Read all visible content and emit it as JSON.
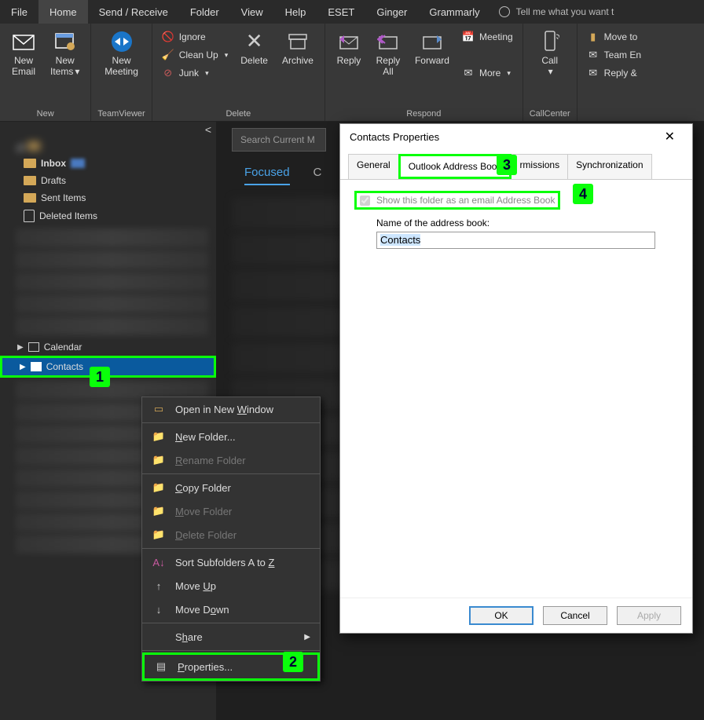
{
  "tabs": {
    "file": "File",
    "home": "Home",
    "sendreceive": "Send / Receive",
    "folder": "Folder",
    "view": "View",
    "help": "Help",
    "eset": "ESET",
    "ginger": "Ginger",
    "grammarly": "Grammarly",
    "tell": "Tell me what you want t"
  },
  "ribbon": {
    "new": {
      "email": "New\nEmail",
      "items": "New\nItems",
      "label": "New"
    },
    "tv": {
      "meeting": "New\nMeeting",
      "label": "TeamViewer"
    },
    "delete": {
      "ignore": "Ignore",
      "cleanup": "Clean Up",
      "junk": "Junk",
      "delete": "Delete",
      "archive": "Archive",
      "label": "Delete"
    },
    "respond": {
      "reply": "Reply",
      "replyall": "Reply\nAll",
      "forward": "Forward",
      "meeting": "Meeting",
      "more": "More",
      "label": "Respond"
    },
    "call": {
      "call": "Call",
      "label": "CallCenter"
    },
    "move": {
      "moveto": "Move to",
      "teamen": "Team En",
      "replyd": "Reply &"
    }
  },
  "search": {
    "placeholder": "Search Current M"
  },
  "focus": {
    "focused": "Focused",
    "other": "C"
  },
  "folders": {
    "inbox": "Inbox",
    "drafts": "Drafts",
    "sent": "Sent Items",
    "deleted": "Deleted Items",
    "calendar": "Calendar",
    "contacts": "Contacts"
  },
  "context": {
    "open": "Open in New Window",
    "newf": "New Folder...",
    "rename": "Rename Folder",
    "copy": "Copy Folder",
    "move": "Move Folder",
    "delete": "Delete Folder",
    "sort": "Sort Subfolders A to Z",
    "moveup": "Move Up",
    "movedown": "Move Down",
    "share": "Share",
    "props": "Properties..."
  },
  "dialog": {
    "title": "Contacts Properties",
    "tabs": {
      "general": "General",
      "oab": "Outlook Address Book",
      "perm": "rmissions",
      "sync": "Synchronization"
    },
    "chk": "Show this folder as an email Address Book",
    "namelbl": "Name of the address book:",
    "nameval": "Contacts",
    "ok": "OK",
    "cancel": "Cancel",
    "apply": "Apply"
  },
  "badges": {
    "b1": "1",
    "b2": "2",
    "b3": "3",
    "b4": "4"
  }
}
